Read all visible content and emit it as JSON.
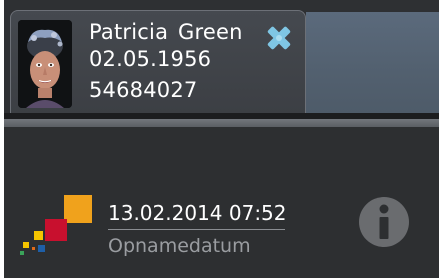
{
  "patient": {
    "name": "Patricia Green",
    "date_of_birth": "02.05.1956",
    "patient_id": "54684027",
    "photo_icon": "patient-avatar",
    "close_icon": "close-x-icon"
  },
  "recording": {
    "datetime": "13.02.2014 07:52",
    "label": "Opnamedatum"
  },
  "icons": {
    "logo": "colored-squares-logo",
    "info": "info-icon"
  },
  "colors": {
    "close_icon": "#7fc6e4",
    "logo_orange": "#f0a21c",
    "logo_red": "#c8102e",
    "logo_yellow": "#f5c400",
    "logo_blue": "#1e5fa8",
    "logo_green": "#3aa35a",
    "info_icon": "#6a6c6f"
  }
}
